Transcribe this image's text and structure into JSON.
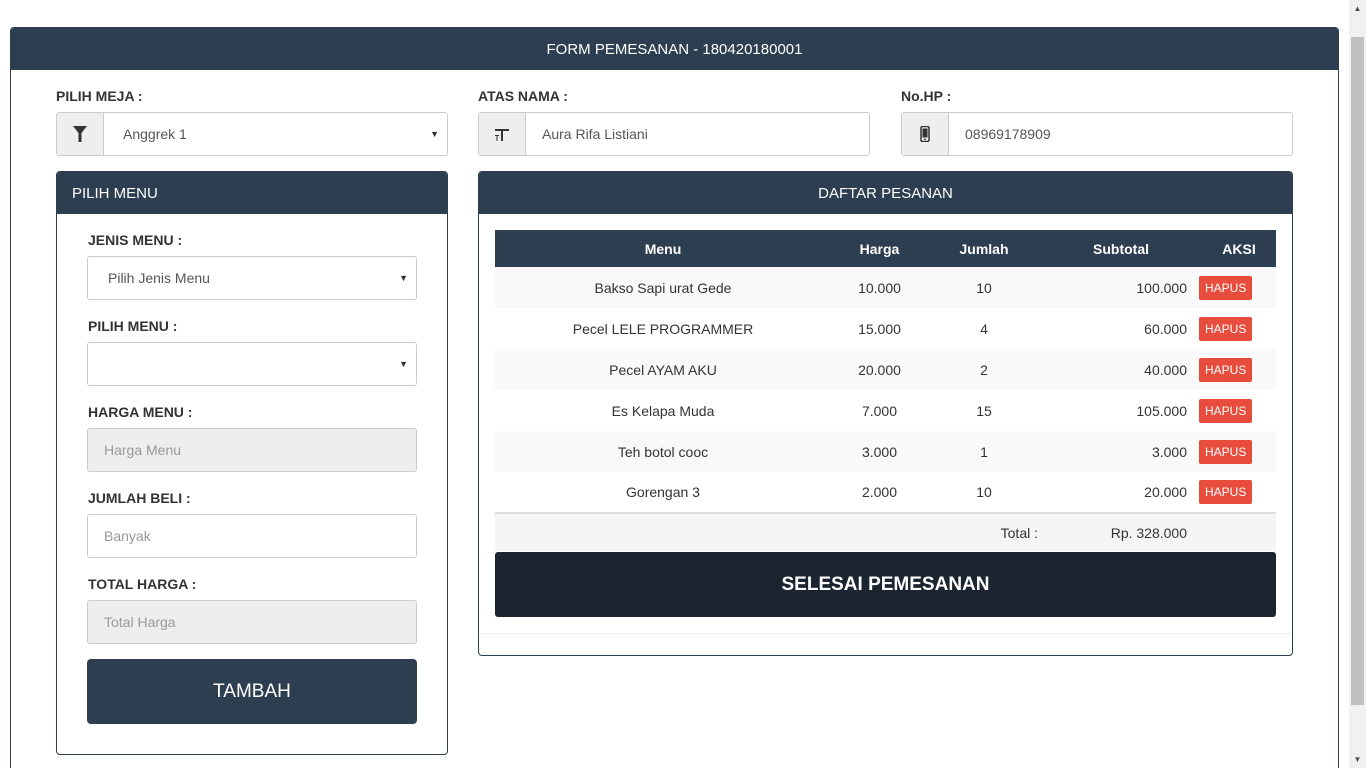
{
  "form": {
    "title": "FORM PEMESANAN - 180420180001"
  },
  "meja": {
    "label": "PILIH MEJA :",
    "value": "Anggrek 1"
  },
  "nama": {
    "label": "ATAS NAMA :",
    "value": "Aura Rifa Listiani"
  },
  "hp": {
    "label": "No.HP :",
    "value": "08969178909"
  },
  "pilih_menu_panel": {
    "title": "PILIH MENU",
    "jenis_label": "JENIS MENU :",
    "jenis_value": "Pilih Jenis Menu",
    "menu_label": "PILIH MENU :",
    "menu_value": "",
    "harga_label": "HARGA MENU :",
    "harga_placeholder": "Harga Menu",
    "jumlah_label": "JUMLAH BELI :",
    "jumlah_placeholder": "Banyak",
    "total_label": "TOTAL HARGA :",
    "total_placeholder": "Total Harga",
    "tambah_label": "TAMBAH"
  },
  "daftar": {
    "title": "DAFTAR PESANAN",
    "columns": [
      "Menu",
      "Harga",
      "Jumlah",
      "Subtotal",
      "AKSI"
    ],
    "rows": [
      {
        "menu": "Bakso Sapi urat Gede",
        "harga": "10.000",
        "jumlah": "10",
        "subtotal": "100.000",
        "aksi": "HAPUS"
      },
      {
        "menu": "Pecel LELE PROGRAMMER",
        "harga": "15.000",
        "jumlah": "4",
        "subtotal": "60.000",
        "aksi": "HAPUS"
      },
      {
        "menu": "Pecel AYAM AKU",
        "harga": "20.000",
        "jumlah": "2",
        "subtotal": "40.000",
        "aksi": "HAPUS"
      },
      {
        "menu": "Es Kelapa Muda",
        "harga": "7.000",
        "jumlah": "15",
        "subtotal": "105.000",
        "aksi": "HAPUS"
      },
      {
        "menu": "Teh botol cooc",
        "harga": "3.000",
        "jumlah": "1",
        "subtotal": "3.000",
        "aksi": "HAPUS"
      },
      {
        "menu": "Gorengan 3",
        "harga": "2.000",
        "jumlah": "10",
        "subtotal": "20.000",
        "aksi": "HAPUS"
      }
    ],
    "total_label": "Total :",
    "total_value": "Rp. 328.000",
    "selesai_label": "SELESAI PEMESANAN"
  },
  "icons": {
    "meja": "filter-icon",
    "nama": "text-height-icon",
    "hp": "mobile-phone-icon"
  },
  "colors": {
    "primary": "#2c3e50",
    "danger": "#e74c3c",
    "dark": "#1a252f"
  }
}
